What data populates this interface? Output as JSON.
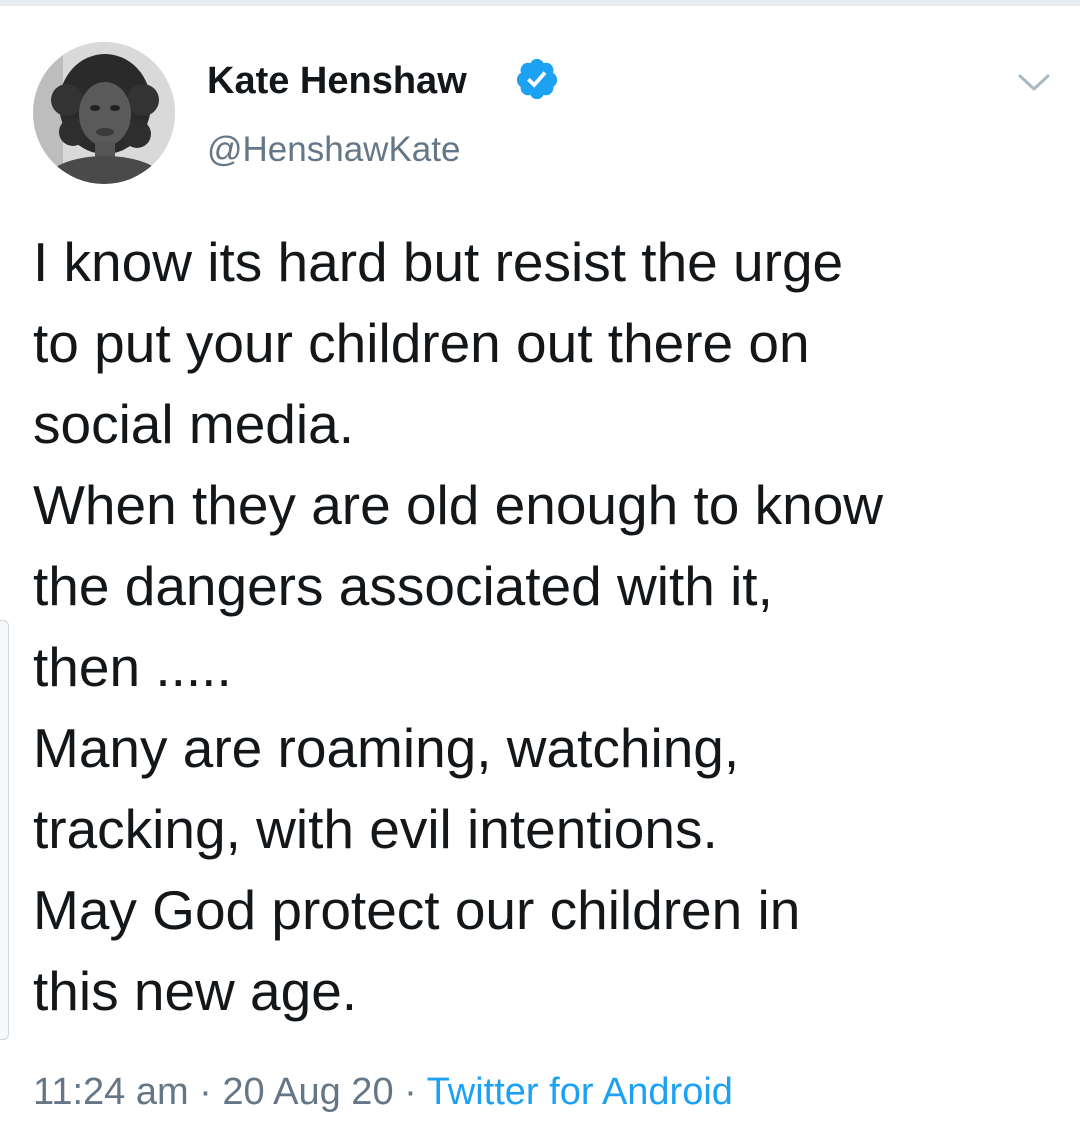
{
  "tweet": {
    "author": {
      "display_name": "Kate Henshaw",
      "handle": "@HenshawKate",
      "verified": true,
      "verified_icon": "verified-badge-icon",
      "avatar_icon": "avatar-photo"
    },
    "menu_icon": "chevron-down-icon",
    "text_lines": [
      "I know its hard but resist the urge",
      "to put your children out there on",
      "social media.",
      "When they are old enough to know",
      "the dangers associated with it,",
      "then .....",
      "Many are roaming, watching,",
      "tracking, with evil intentions.",
      "May God protect our children in",
      "this new age."
    ],
    "time": "11:24 am",
    "separator": " · ",
    "date": "20 Aug 20",
    "source": "Twitter for Android"
  },
  "colors": {
    "text": "#14171a",
    "secondary_text": "#657786",
    "link": "#1da1f2",
    "verified": "#1da1f2"
  }
}
